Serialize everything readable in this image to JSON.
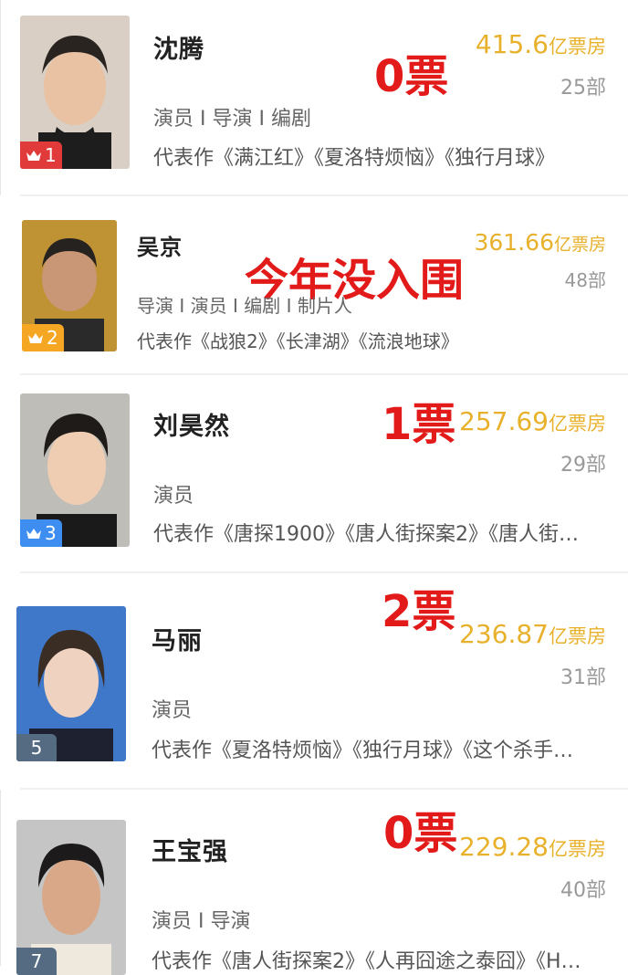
{
  "colors": {
    "gold": "#e8b12b",
    "red_annotation": "#e21a1a",
    "rank1": "#e03a3a",
    "rank2": "#f5a623",
    "rank3": "#3d8ef0",
    "rank_other": "#556b82"
  },
  "people": [
    {
      "rank": "1",
      "name": "沈腾",
      "roles": "演员 I 导演 I 编剧",
      "works": "代表作《满江红》《夏洛特烦恼》《独行月球》",
      "box_office": "415.6",
      "unit": "亿票房",
      "films": "25部",
      "annotation": "0票",
      "badge_icon": "crown-icon"
    },
    {
      "rank": "2",
      "name": "吴京",
      "roles": "导演 I 演员 I 编剧 I 制片人",
      "works": "代表作《战狼2》《长津湖》《流浪地球》",
      "box_office": "361.66",
      "unit": "亿票房",
      "films": "48部",
      "annotation": "今年没入围",
      "badge_icon": "crown-icon"
    },
    {
      "rank": "3",
      "name": "刘昊然",
      "roles": "演员",
      "works": "代表作《唐探1900》《唐人街探案2》《唐人街…",
      "box_office": "257.69",
      "unit": "亿票房",
      "films": "29部",
      "annotation": "1票",
      "badge_icon": "crown-icon"
    },
    {
      "rank": "5",
      "name": "马丽",
      "roles": "演员",
      "works": "代表作《夏洛特烦恼》《独行月球》《这个杀手…",
      "box_office": "236.87",
      "unit": "亿票房",
      "films": "31部",
      "annotation": "2票"
    },
    {
      "rank": "7",
      "name": "王宝强",
      "roles": "演员 I 导演",
      "works": "代表作《唐人街探案2》《人再囧途之泰囧》《H…",
      "box_office": "229.28",
      "unit": "亿票房",
      "films": "40部",
      "annotation": "0票"
    }
  ]
}
